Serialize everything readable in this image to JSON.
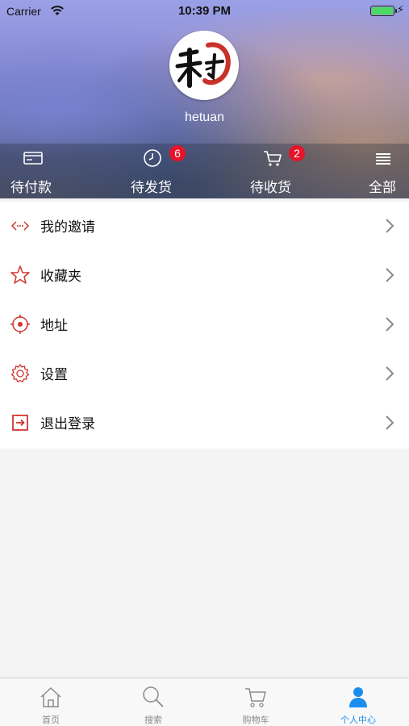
{
  "status_bar": {
    "carrier": "Carrier",
    "time": "10:39 PM"
  },
  "profile": {
    "username": "hetuan",
    "avatar_icon": "hetuan-logo-avatar"
  },
  "orders": [
    {
      "label": "待付款",
      "icon": "card-icon",
      "badge": ""
    },
    {
      "label": "待发货",
      "icon": "clock-icon",
      "badge": "6"
    },
    {
      "label": "待收货",
      "icon": "cart-icon",
      "badge": "2"
    },
    {
      "label": "全部",
      "icon": "list-icon",
      "badge": ""
    }
  ],
  "menu": [
    {
      "label": "我的邀请",
      "icon": "invite-icon"
    },
    {
      "label": "收藏夹",
      "icon": "star-icon"
    },
    {
      "label": "地址",
      "icon": "location-icon"
    },
    {
      "label": "设置",
      "icon": "gear-icon"
    },
    {
      "label": "退出登录",
      "icon": "logout-icon"
    }
  ],
  "tabs": [
    {
      "label": "首页",
      "icon": "home-icon",
      "active": false
    },
    {
      "label": "搜索",
      "icon": "search-icon",
      "active": false
    },
    {
      "label": "购物车",
      "icon": "cart-icon",
      "active": false
    },
    {
      "label": "个人中心",
      "icon": "person-icon",
      "active": true
    }
  ],
  "colors": {
    "accent": "#1a8ef0",
    "badge": "#e8132a",
    "menu_icon": "#d0352d"
  }
}
